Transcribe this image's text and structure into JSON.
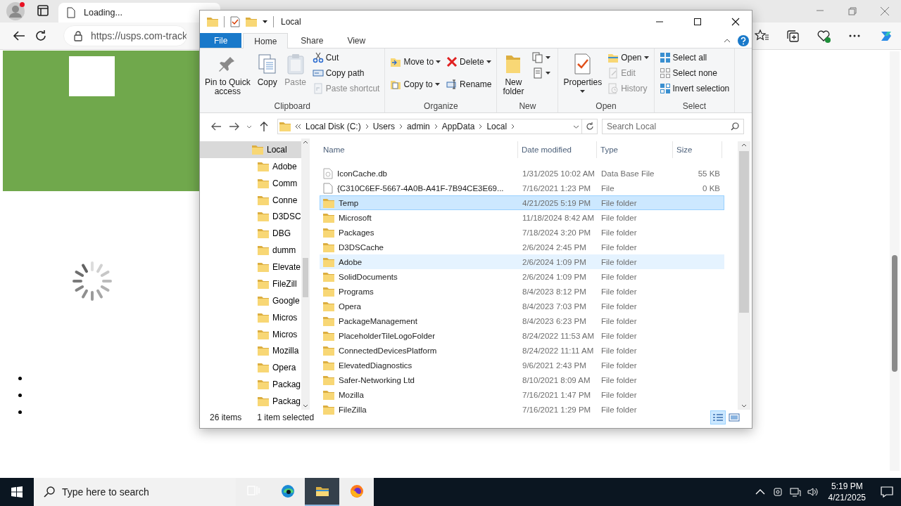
{
  "browser": {
    "tab": {
      "title": "Loading..."
    },
    "address": {
      "url": "https://usps.com-track"
    },
    "page": {
      "loading": true
    }
  },
  "explorer": {
    "title": "Local",
    "tabs": [
      {
        "label": "File",
        "kind": "file",
        "selected": false
      },
      {
        "label": "Home",
        "kind": "tab",
        "selected": true
      },
      {
        "label": "Share",
        "kind": "tab",
        "selected": false
      },
      {
        "label": "View",
        "kind": "tab",
        "selected": false
      }
    ],
    "ribbon": [
      {
        "label": "Clipboard",
        "columns": [
          [
            {
              "kind": "large",
              "label": "Pin to Quick\naccess",
              "disabled": false,
              "dropdown": false
            }
          ],
          [
            {
              "kind": "large",
              "label": "Copy",
              "disabled": false,
              "dropdown": false
            }
          ],
          [
            {
              "kind": "large",
              "label": "Paste",
              "disabled": true,
              "dropdown": false
            }
          ],
          [
            {
              "kind": "small",
              "label": "Cut",
              "disabled": false,
              "dropdown": false
            },
            {
              "kind": "small",
              "label": "Copy path",
              "disabled": false,
              "dropdown": false
            },
            {
              "kind": "small",
              "label": "Paste shortcut",
              "disabled": true,
              "dropdown": false
            }
          ]
        ]
      },
      {
        "label": "Organize",
        "columns": [
          [
            {
              "kind": "small",
              "label": "Move to",
              "disabled": false,
              "dropdown": true
            },
            {
              "kind": "small",
              "label": "Copy to",
              "disabled": false,
              "dropdown": true
            }
          ],
          [
            {
              "kind": "small",
              "label": "Delete",
              "disabled": false,
              "dropdown": true
            },
            {
              "kind": "small",
              "label": "Rename",
              "disabled": false,
              "dropdown": false
            }
          ]
        ]
      },
      {
        "label": "New",
        "columns": [
          [
            {
              "kind": "large",
              "label": "New\nfolder",
              "disabled": false,
              "dropdown": false
            }
          ],
          [
            {
              "kind": "icon",
              "disabled": false,
              "dropdown": true
            },
            {
              "kind": "icon",
              "disabled": false,
              "dropdown": true
            }
          ]
        ]
      },
      {
        "label": "Open",
        "columns": [
          [
            {
              "kind": "large",
              "label": "Properties",
              "disabled": false,
              "dropdown": true
            }
          ],
          [
            {
              "kind": "small",
              "label": "Open",
              "disabled": false,
              "dropdown": true
            },
            {
              "kind": "small",
              "label": "Edit",
              "disabled": true,
              "dropdown": false
            },
            {
              "kind": "small",
              "label": "History",
              "disabled": true,
              "dropdown": false
            }
          ]
        ]
      },
      {
        "label": "Select",
        "columns": [
          [
            {
              "kind": "small",
              "label": "Select all",
              "disabled": false,
              "dropdown": false
            },
            {
              "kind": "small",
              "label": "Select none",
              "disabled": false,
              "dropdown": false
            },
            {
              "kind": "small",
              "label": "Invert selection",
              "disabled": false,
              "dropdown": false
            }
          ]
        ]
      }
    ],
    "address": {
      "crumbs": [
        "Local Disk (C:)",
        "Users",
        "admin",
        "AppData",
        "Local"
      ]
    },
    "search": {
      "placeholder": "Search Local"
    },
    "nav": {
      "items": [
        {
          "label": "Local",
          "selected": true,
          "children": [
            {
              "label": "Adobe",
              "selected": false
            },
            {
              "label": "Comm",
              "selected": false
            },
            {
              "label": "Conne",
              "selected": false
            },
            {
              "label": "D3DSC",
              "selected": false
            },
            {
              "label": "DBG",
              "selected": false
            },
            {
              "label": "dumm",
              "selected": false
            },
            {
              "label": "Elevate",
              "selected": false
            },
            {
              "label": "FileZill",
              "selected": false
            },
            {
              "label": "Google",
              "selected": false
            },
            {
              "label": "Micros",
              "selected": false
            },
            {
              "label": "Micros",
              "selected": false
            },
            {
              "label": "Mozilla",
              "selected": false
            },
            {
              "label": "Opera",
              "selected": false
            },
            {
              "label": "Packag",
              "selected": false
            },
            {
              "label": "Packag",
              "selected": false
            }
          ]
        }
      ]
    },
    "files": {
      "columns": [
        "Name",
        "Date modified",
        "Type",
        "Size"
      ],
      "rows": [
        {
          "kind": "db",
          "name": "IconCache.db",
          "date": "1/31/2025 10:02 AM",
          "type": "Data Base File",
          "size": "55 KB",
          "selected": false,
          "hot": false
        },
        {
          "kind": "file",
          "name": "{C310C6EF-5667-4A0B-A41F-7B94CE3E69...",
          "date": "7/16/2021 1:23 PM",
          "type": "File",
          "size": "0 KB",
          "selected": false,
          "hot": false
        },
        {
          "kind": "folder",
          "name": "Temp",
          "date": "4/21/2025 5:19 PM",
          "type": "File folder",
          "selected": true,
          "hot": false
        },
        {
          "kind": "folder",
          "name": "Microsoft",
          "date": "11/18/2024 8:42 AM",
          "type": "File folder",
          "selected": false,
          "hot": false
        },
        {
          "kind": "folder",
          "name": "Packages",
          "date": "7/18/2024 3:20 PM",
          "type": "File folder",
          "selected": false,
          "hot": false
        },
        {
          "kind": "folder",
          "name": "D3DSCache",
          "date": "2/6/2024 2:45 PM",
          "type": "File folder",
          "selected": false,
          "hot": false
        },
        {
          "kind": "folder",
          "name": "Adobe",
          "date": "2/6/2024 1:09 PM",
          "type": "File folder",
          "selected": false,
          "hot": true
        },
        {
          "kind": "folder",
          "name": "SolidDocuments",
          "date": "2/6/2024 1:09 PM",
          "type": "File folder",
          "selected": false,
          "hot": false
        },
        {
          "kind": "folder",
          "name": "Programs",
          "date": "8/4/2023 8:12 PM",
          "type": "File folder",
          "selected": false,
          "hot": false
        },
        {
          "kind": "folder",
          "name": "Opera",
          "date": "8/4/2023 7:03 PM",
          "type": "File folder",
          "selected": false,
          "hot": false
        },
        {
          "kind": "folder",
          "name": "PackageManagement",
          "date": "8/4/2023 6:23 PM",
          "type": "File folder",
          "selected": false,
          "hot": false
        },
        {
          "kind": "folder",
          "name": "PlaceholderTileLogoFolder",
          "date": "8/24/2022 11:53 AM",
          "type": "File folder",
          "selected": false,
          "hot": false
        },
        {
          "kind": "folder",
          "name": "ConnectedDevicesPlatform",
          "date": "8/24/2022 11:11 AM",
          "type": "File folder",
          "selected": false,
          "hot": false
        },
        {
          "kind": "folder",
          "name": "ElevatedDiagnostics",
          "date": "9/6/2021 2:43 PM",
          "type": "File folder",
          "selected": false,
          "hot": false
        },
        {
          "kind": "folder",
          "name": "Safer-Networking Ltd",
          "date": "8/10/2021 8:09 AM",
          "type": "File folder",
          "selected": false,
          "hot": false
        },
        {
          "kind": "folder",
          "name": "Mozilla",
          "date": "7/16/2021 1:47 PM",
          "type": "File folder",
          "selected": false,
          "hot": false
        },
        {
          "kind": "folder",
          "name": "FileZilla",
          "date": "7/16/2021 1:29 PM",
          "type": "File folder",
          "selected": false,
          "hot": false
        }
      ]
    },
    "status_bar": {
      "count": "26 items",
      "selection": "1 item selected",
      "views": [
        {
          "kind": "details",
          "selected": true
        },
        {
          "kind": "large",
          "selected": false
        }
      ]
    }
  },
  "taskbar": {
    "search": {
      "placeholder": "Type here to search"
    },
    "apps": [
      {
        "kind": "taskview",
        "active": false
      },
      {
        "kind": "edge",
        "active": false
      },
      {
        "kind": "explorer",
        "active": true
      },
      {
        "kind": "firefox",
        "active": false
      }
    ],
    "time": "5:19 PM",
    "date": "4/21/2025"
  }
}
